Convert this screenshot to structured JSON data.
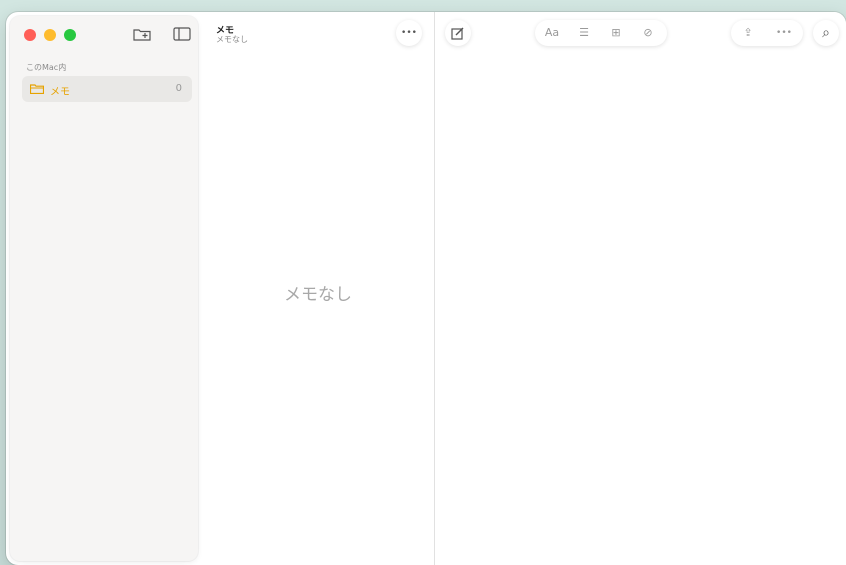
{
  "sidebar": {
    "section_label": "このMac内",
    "folder": {
      "name": "メモ",
      "count": "0"
    },
    "icons": {
      "folder_new": "folder-add-icon",
      "toggle": "sidebar-icon"
    }
  },
  "note_list": {
    "title": "メモ",
    "subtitle": "メモなし",
    "more_icon": "•••",
    "empty_message": "メモなし"
  },
  "editor": {
    "compose_icon": "✎",
    "toolbar": {
      "format": "Aa",
      "checklist": "☰",
      "table": "⊞",
      "attach": "⊘"
    },
    "share_icon": "⇪",
    "more_icon": "•••",
    "search_icon": "⌕"
  },
  "colors": {
    "accent": "#e6a200",
    "close": "#ff5f57",
    "minimize": "#febc2e",
    "zoom": "#28c840"
  }
}
